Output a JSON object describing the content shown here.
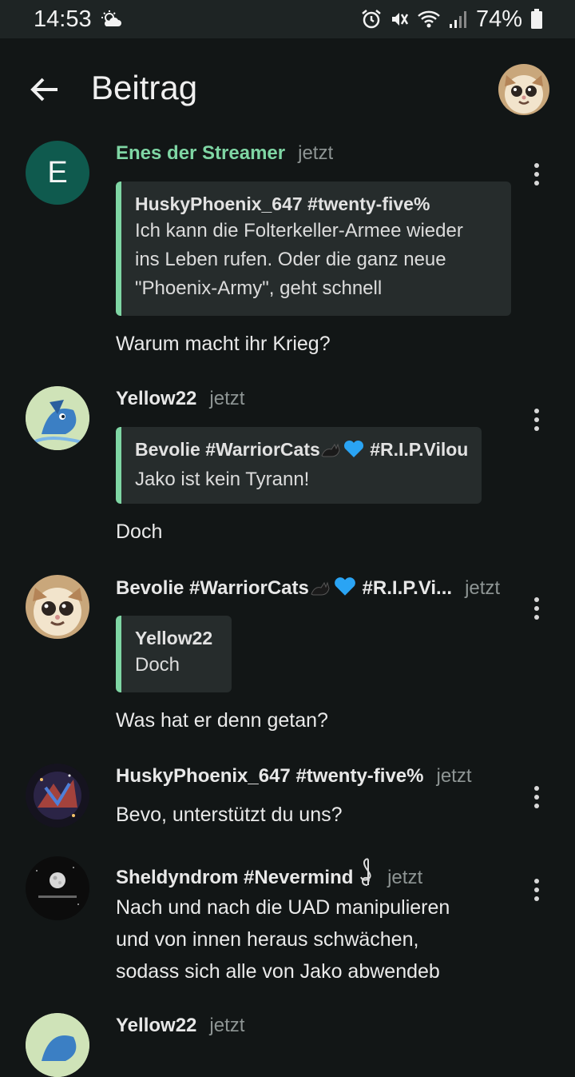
{
  "status": {
    "time": "14:53",
    "battery": "74%",
    "icons": [
      "weather-icon",
      "alarm-icon",
      "mute-icon",
      "wifi-icon",
      "signal-icon",
      "battery-icon"
    ]
  },
  "appbar": {
    "title": "Beitrag",
    "icons": [
      "back-arrow-icon",
      "avatar"
    ]
  },
  "posts": [
    {
      "author": "Enes der Streamer",
      "time": "jetzt",
      "avatar_letter": "E",
      "quote_author": "HuskyPhoenix_647 #twenty-five%",
      "quote_lines": [
        "Ich kann die Folterkeller-Armee wieder",
        "ins Leben rufen. Oder die ganz neue",
        "\"Phoenix-Army\", geht schnell"
      ],
      "text": "Warum macht ihr Krieg?"
    },
    {
      "author": "Yellow22",
      "time": "jetzt",
      "quote_author": "Bevolie #WarriorCats",
      "quote_author_suffix": "#R.I.P.Vilou",
      "quote_lines": [
        "Jako ist kein Tyrann!"
      ],
      "text": "Doch"
    },
    {
      "author": "Bevolie #WarriorCats",
      "author_suffix": "#R.I.P.Vi...",
      "time": "jetzt",
      "quote_author": "Yellow22",
      "quote_lines": [
        "Doch"
      ],
      "text": "Was hat er denn getan?"
    },
    {
      "author": "HuskyPhoenix_647 #twenty-five%",
      "time": "jetzt",
      "text": "Bevo, unterstützt du uns?"
    },
    {
      "author": "Sheldyndrom #Nevermind",
      "time": "jetzt",
      "text_lines": [
        "Nach und nach die UAD manipulieren",
        "und von innen heraus schwächen,",
        "sodass sich alle von Jako abwendeb"
      ]
    },
    {
      "author": "Yellow22",
      "time": "jetzt"
    }
  ],
  "colors": {
    "background": "#121616",
    "accent": "#7fd6a4",
    "quote_bg": "#262c2c"
  }
}
